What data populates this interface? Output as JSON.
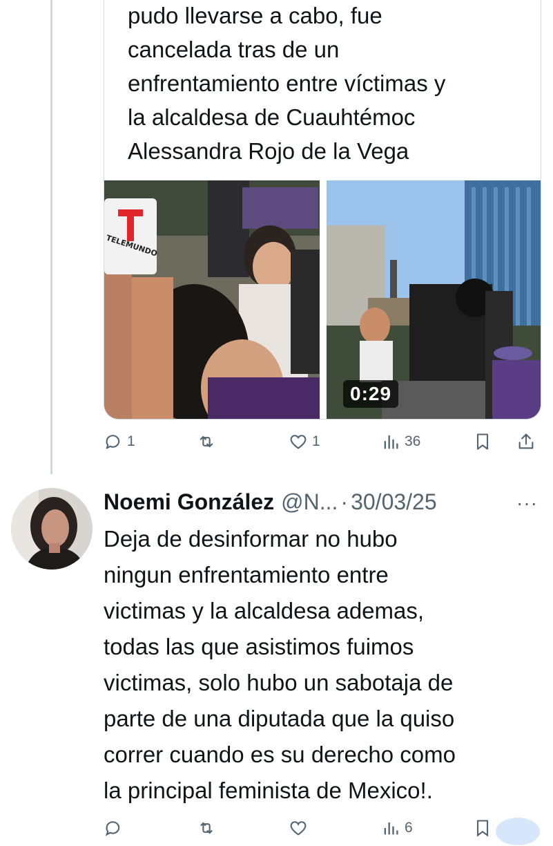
{
  "quoted_post": {
    "text": "pudo llevarse a cabo, fue\ncancelada tras  de un\nenfrentamiento entre víctimas y\nla alcaldesa de Cuauhtémoc\nAlessandra Rojo de la Vega",
    "media_left_brand": "TELEMUNDO",
    "video_duration": "0:29"
  },
  "post_actions": {
    "replies": "1",
    "reposts": "",
    "likes": "1",
    "views": "36"
  },
  "reply": {
    "name": "Noemi González",
    "handle": "@N...",
    "separator": "·",
    "date": "30/03/25",
    "more": "···",
    "text": "Deja de desinformar no hubo\nningun enfrentamiento entre\nvictimas y la alcaldesa ademas,\ntodas las que asistimos fuimos\nvictimas, solo hubo un sabotaja de\nparte de una diputada que la quiso\ncorrer cuando es su derecho como\nla principal feminista de Mexico!.",
    "actions": {
      "replies": "",
      "reposts": "",
      "likes": "",
      "views": "6"
    }
  },
  "colors": {
    "text": "#0f1419",
    "muted": "#536471",
    "border": "#cfd9de"
  },
  "icons": [
    "reply-icon",
    "repost-icon",
    "like-icon",
    "views-icon",
    "bookmark-icon",
    "share-icon",
    "more-icon"
  ]
}
